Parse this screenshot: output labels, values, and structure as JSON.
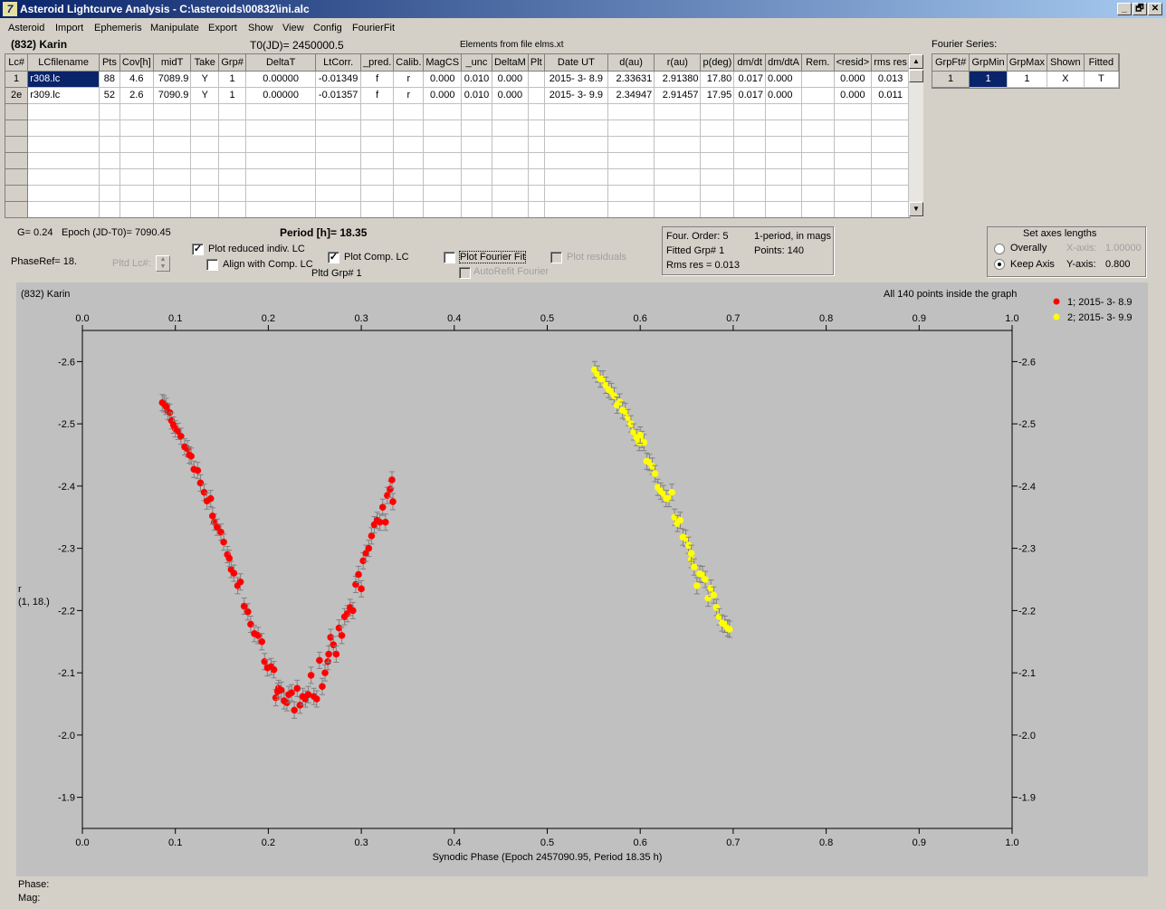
{
  "window": {
    "title": "Asteroid Lightcurve Analysis - C:\\asteroids\\00832\\ini.alc",
    "icon_glyph": "7",
    "buttons": [
      "_",
      "🗗",
      "✕"
    ]
  },
  "menu": [
    "Asteroid",
    "Import",
    "Ephemeris",
    "Manipulate",
    "Export",
    "Show",
    "View",
    "Config",
    "FourierFit"
  ],
  "header": {
    "asteroid_name": "(832) Karin",
    "t0": "T0(JD)= 2450000.5",
    "elements": "Elements from file elms.xt",
    "fourier_series_label": "Fourier Series:"
  },
  "lc_table": {
    "columns": [
      "Lc#",
      "LCfilename",
      "Pts",
      "Cov[h]",
      "midT",
      "Take",
      "Grp#",
      "DeltaT",
      "LtCorr.",
      "_pred.",
      "Calib.",
      "MagCS",
      "_unc",
      "DeltaM",
      "Plt",
      "Date UT",
      "d(au)",
      "r(au)",
      "p(deg)",
      "dm/dt",
      "dm/dtA",
      "Rem.",
      "<resid>",
      "rms res"
    ],
    "rows": [
      [
        "1",
        "r308.lc",
        "88",
        "4.6",
        "7089.9",
        "Y",
        "1",
        "0.00000",
        "-0.01349",
        "f",
        "r",
        "0.000",
        "0.010",
        "0.000",
        "",
        "2015- 3- 8.9",
        "2.33631",
        "2.91380",
        "17.80",
        "0.017",
        "0.000",
        "",
        "0.000",
        "0.013"
      ],
      [
        "2e",
        "r309.lc",
        "52",
        "2.6",
        "7090.9",
        "Y",
        "1",
        "0.00000",
        "-0.01357",
        "f",
        "r",
        "0.000",
        "0.010",
        "0.000",
        "",
        "2015- 3- 9.9",
        "2.34947",
        "2.91457",
        "17.95",
        "0.017",
        "0.000",
        "",
        "0.000",
        "0.011"
      ]
    ]
  },
  "fourier_table": {
    "columns": [
      "GrpFt#",
      "GrpMin",
      "GrpMax",
      "Shown",
      "Fitted"
    ],
    "rows": [
      [
        "1",
        "1",
        "1",
        "X",
        "T"
      ]
    ]
  },
  "controls": {
    "g_value": "G= 0.24",
    "epoch": "Epoch (JD-T0)= 7090.45",
    "period": "Period [h]= 18.35",
    "phaseref": "PhaseRef= 18.",
    "pltd_lc_label": "Pltd Lc#:",
    "plot_reduced_label": "Plot reduced indiv. LC",
    "plot_reduced_checked": true,
    "align_label": "Align with Comp. LC",
    "align_checked": false,
    "plot_comp_label": "Plot Comp. LC",
    "plot_comp_checked": true,
    "pltd_grp": "Pltd Grp#  1",
    "plot_fourier_label": "Plot Fourier Fit",
    "plot_fourier_checked": false,
    "autorefit_label": "AutoRefit Fourier",
    "plot_residuals_label": "Plot residuals",
    "four_order": "Four. Order:  5",
    "one_period": "1-period, in mags",
    "fitted_grp": "Fitted Grp# 1",
    "points": "Points: 140",
    "rms_res": "Rms res     = 0.013",
    "axes_title": "Set axes lengths",
    "overally_label": "Overally",
    "keep_axis_label": "Keep Axis",
    "xaxis_label": "X-axis:",
    "xaxis_value": "1.00000",
    "yaxis_label": "Y-axis:",
    "yaxis_value": "0.800"
  },
  "plot_header": {
    "name": "(832) Karin",
    "all_points": "All 140 points inside the graph"
  },
  "status": {
    "phase_label": "Phase:",
    "mag_label": "Mag:"
  },
  "colors": {
    "series1": "#ff0000",
    "series2": "#ffff00",
    "plot_bg": "#c0c0c0",
    "errorbar": "#808080",
    "selection": "#0a246a"
  },
  "chart_data": {
    "type": "scatter",
    "title": "",
    "xlabel": "Synodic Phase (Epoch 2457090.95, Period 18.35 h)",
    "ylabel_lines": [
      "r",
      "(1, 18.)"
    ],
    "xlim": [
      0.0,
      1.0
    ],
    "ylim": [
      -2.65,
      -1.85
    ],
    "y_inverted": true,
    "xticks": [
      "0.0",
      "0.1",
      "0.2",
      "0.3",
      "0.4",
      "0.5",
      "0.6",
      "0.7",
      "0.8",
      "0.9",
      "1.0"
    ],
    "yticks": [
      "-2.6",
      "-2.5",
      "-2.4",
      "-2.3",
      "-2.2",
      "-2.1",
      "-2.0",
      "-1.9"
    ],
    "grid": false,
    "legend_position": "top-right",
    "series": [
      {
        "name": "1; 2015- 3- 8.9",
        "color": "#ff0000",
        "points": [
          [
            0.086,
            -2.534
          ],
          [
            0.088,
            -2.532
          ],
          [
            0.092,
            -2.52
          ],
          [
            0.094,
            -2.518
          ],
          [
            0.096,
            -2.505
          ],
          [
            0.1,
            -2.492
          ],
          [
            0.103,
            -2.488
          ],
          [
            0.106,
            -2.48
          ],
          [
            0.11,
            -2.463
          ],
          [
            0.113,
            -2.46
          ],
          [
            0.117,
            -2.448
          ],
          [
            0.12,
            -2.427
          ],
          [
            0.124,
            -2.425
          ],
          [
            0.127,
            -2.405
          ],
          [
            0.131,
            -2.39
          ],
          [
            0.134,
            -2.376
          ],
          [
            0.138,
            -2.38
          ],
          [
            0.142,
            -2.342
          ],
          [
            0.145,
            -2.334
          ],
          [
            0.149,
            -2.326
          ],
          [
            0.152,
            -2.31
          ],
          [
            0.156,
            -2.29
          ],
          [
            0.16,
            -2.266
          ],
          [
            0.163,
            -2.26
          ],
          [
            0.167,
            -2.24
          ],
          [
            0.17,
            -2.246
          ],
          [
            0.174,
            -2.207
          ],
          [
            0.178,
            -2.198
          ],
          [
            0.181,
            -2.178
          ],
          [
            0.185,
            -2.163
          ],
          [
            0.189,
            -2.16
          ],
          [
            0.193,
            -2.15
          ],
          [
            0.196,
            -2.118
          ],
          [
            0.199,
            -2.108
          ],
          [
            0.203,
            -2.11
          ],
          [
            0.206,
            -2.105
          ],
          [
            0.208,
            -2.06
          ],
          [
            0.211,
            -2.075
          ],
          [
            0.214,
            -2.072
          ],
          [
            0.217,
            -2.055
          ],
          [
            0.22,
            -2.052
          ],
          [
            0.222,
            -2.065
          ],
          [
            0.225,
            -2.068
          ],
          [
            0.228,
            -2.04
          ],
          [
            0.231,
            -2.075
          ],
          [
            0.234,
            -2.048
          ],
          [
            0.237,
            -2.062
          ],
          [
            0.24,
            -2.058
          ],
          [
            0.243,
            -2.065
          ],
          [
            0.246,
            -2.096
          ],
          [
            0.249,
            -2.062
          ],
          [
            0.252,
            -2.058
          ],
          [
            0.255,
            -2.12
          ],
          [
            0.258,
            -2.078
          ],
          [
            0.261,
            -2.1
          ],
          [
            0.264,
            -2.118
          ],
          [
            0.267,
            -2.157
          ],
          [
            0.27,
            -2.145
          ],
          [
            0.273,
            -2.13
          ],
          [
            0.276,
            -2.172
          ],
          [
            0.279,
            -2.16
          ],
          [
            0.282,
            -2.19
          ],
          [
            0.285,
            -2.195
          ],
          [
            0.288,
            -2.205
          ],
          [
            0.291,
            -2.2
          ],
          [
            0.294,
            -2.242
          ],
          [
            0.297,
            -2.258
          ],
          [
            0.3,
            -2.235
          ],
          [
            0.302,
            -2.28
          ],
          [
            0.305,
            -2.292
          ],
          [
            0.308,
            -2.3
          ],
          [
            0.311,
            -2.32
          ],
          [
            0.314,
            -2.338
          ],
          [
            0.317,
            -2.345
          ],
          [
            0.32,
            -2.342
          ],
          [
            0.323,
            -2.366
          ],
          [
            0.326,
            -2.342
          ],
          [
            0.328,
            -2.385
          ],
          [
            0.331,
            -2.395
          ],
          [
            0.333,
            -2.41
          ],
          [
            0.334,
            -2.375
          ],
          [
            0.09,
            -2.528
          ],
          [
            0.098,
            -2.498
          ],
          [
            0.115,
            -2.45
          ],
          [
            0.14,
            -2.352
          ],
          [
            0.158,
            -2.284
          ],
          [
            0.21,
            -2.07
          ],
          [
            0.265,
            -2.13
          ]
        ]
      },
      {
        "name": "2; 2015- 3- 9.9",
        "color": "#ffff00",
        "points": [
          [
            0.551,
            -2.587
          ],
          [
            0.554,
            -2.58
          ],
          [
            0.557,
            -2.572
          ],
          [
            0.56,
            -2.572
          ],
          [
            0.563,
            -2.562
          ],
          [
            0.566,
            -2.555
          ],
          [
            0.569,
            -2.552
          ],
          [
            0.572,
            -2.545
          ],
          [
            0.575,
            -2.53
          ],
          [
            0.578,
            -2.535
          ],
          [
            0.581,
            -2.522
          ],
          [
            0.584,
            -2.52
          ],
          [
            0.587,
            -2.51
          ],
          [
            0.59,
            -2.5
          ],
          [
            0.593,
            -2.487
          ],
          [
            0.596,
            -2.478
          ],
          [
            0.599,
            -2.47
          ],
          [
            0.602,
            -2.475
          ],
          [
            0.604,
            -2.47
          ],
          [
            0.607,
            -2.44
          ],
          [
            0.61,
            -2.438
          ],
          [
            0.613,
            -2.432
          ],
          [
            0.616,
            -2.42
          ],
          [
            0.619,
            -2.398
          ],
          [
            0.622,
            -2.392
          ],
          [
            0.625,
            -2.388
          ],
          [
            0.628,
            -2.38
          ],
          [
            0.631,
            -2.38
          ],
          [
            0.634,
            -2.39
          ],
          [
            0.637,
            -2.35
          ],
          [
            0.64,
            -2.34
          ],
          [
            0.643,
            -2.345
          ],
          [
            0.646,
            -2.318
          ],
          [
            0.649,
            -2.316
          ],
          [
            0.652,
            -2.305
          ],
          [
            0.655,
            -2.282
          ],
          [
            0.658,
            -2.27
          ],
          [
            0.661,
            -2.24
          ],
          [
            0.664,
            -2.259
          ],
          [
            0.667,
            -2.258
          ],
          [
            0.67,
            -2.25
          ],
          [
            0.673,
            -2.22
          ],
          [
            0.676,
            -2.236
          ],
          [
            0.679,
            -2.225
          ],
          [
            0.682,
            -2.205
          ],
          [
            0.685,
            -2.19
          ],
          [
            0.688,
            -2.18
          ],
          [
            0.691,
            -2.178
          ],
          [
            0.694,
            -2.172
          ],
          [
            0.696,
            -2.17
          ],
          [
            0.6,
            -2.482
          ],
          [
            0.655,
            -2.292
          ]
        ]
      }
    ]
  }
}
